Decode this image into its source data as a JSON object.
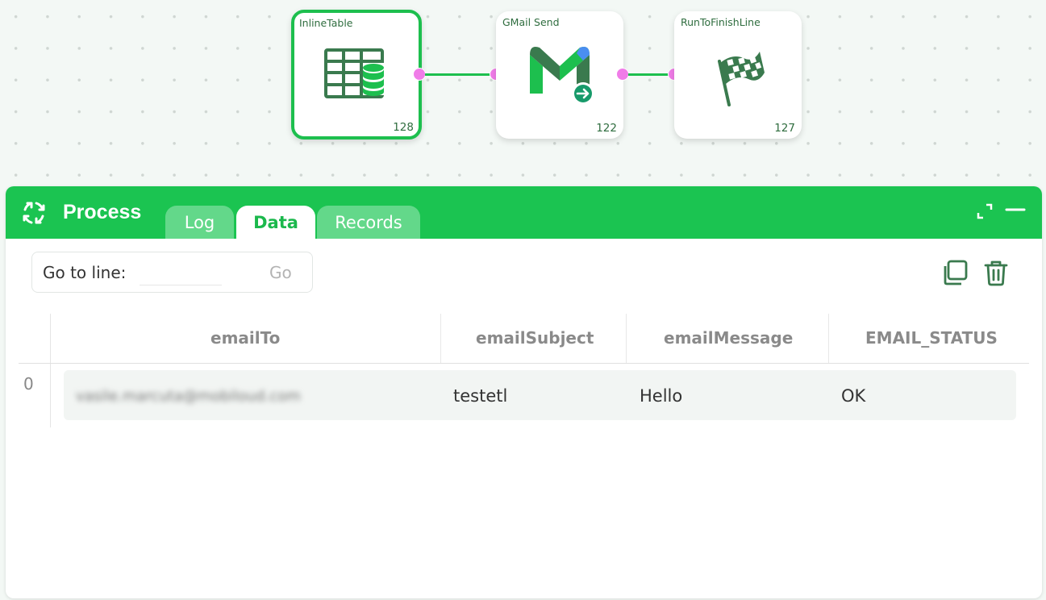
{
  "flow": {
    "nodes": [
      {
        "title": "InlineTable",
        "count": "128",
        "icon": "inline-table-icon",
        "selected": true
      },
      {
        "title": "GMail Send",
        "count": "122",
        "icon": "gmail-send-icon",
        "selected": false
      },
      {
        "title": "RunToFinishLine",
        "count": "127",
        "icon": "finish-flag-icon",
        "selected": false
      }
    ]
  },
  "panel": {
    "title": "Process",
    "tabs": [
      {
        "label": "Log",
        "active": false
      },
      {
        "label": "Data",
        "active": true
      },
      {
        "label": "Records",
        "active": false
      }
    ],
    "goto": {
      "label": "Go to line:",
      "value": "",
      "button": "Go"
    },
    "table": {
      "columns": [
        "emailTo",
        "emailSubject",
        "emailMessage",
        "EMAIL_STATUS"
      ],
      "rows": [
        {
          "index": "0",
          "cells": [
            "vasile.marcuta@mobiloud.com",
            "testetl",
            "Hello",
            "OK"
          ]
        }
      ]
    }
  },
  "colors": {
    "accent": "#1bc451",
    "tab_inactive": "#63d88a",
    "port": "#f07ce8",
    "icon_green": "#3a7a4e"
  }
}
